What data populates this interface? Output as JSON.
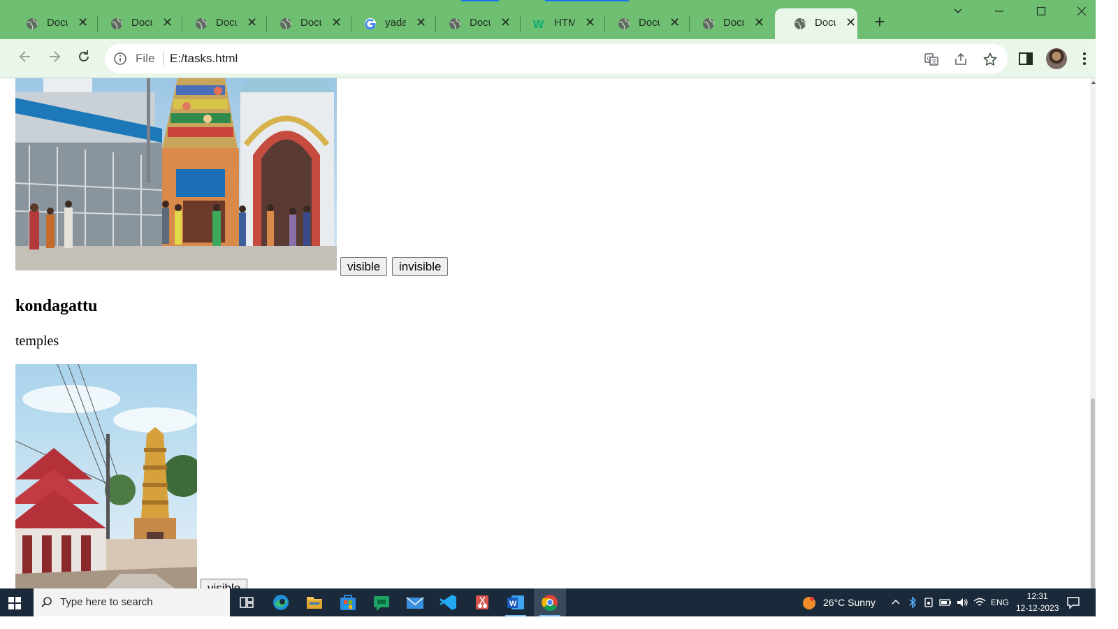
{
  "browser": {
    "tabs": [
      {
        "title": "Docu",
        "favicon": "globe-icon"
      },
      {
        "title": "Docu",
        "favicon": "globe-icon"
      },
      {
        "title": "Docu",
        "favicon": "globe-icon"
      },
      {
        "title": "Docu",
        "favicon": "globe-icon"
      },
      {
        "title": "yada",
        "favicon": "google-icon"
      },
      {
        "title": "Docu",
        "favicon": "globe-icon"
      },
      {
        "title": "HTM",
        "favicon": "w3schools-icon"
      },
      {
        "title": "Docu",
        "favicon": "globe-icon"
      },
      {
        "title": "Docu",
        "favicon": "globe-icon"
      },
      {
        "title": "Docu",
        "favicon": "globe-icon",
        "active": true
      }
    ],
    "tab_close_glyph": "✕",
    "new_tab_glyph": "+",
    "address_scheme_label": "File",
    "address_url": "E:/tasks.html",
    "accent_color": "#6fbf73",
    "toolbar_color": "#eaf6ea"
  },
  "page": {
    "block1": {
      "image_alt": "temple with colorful gopuram",
      "visible_button": "visible",
      "invisible_button": "invisible"
    },
    "heading": "kondagattu",
    "paragraph": "temples",
    "block2": {
      "image_alt": "kondagattu temple",
      "visible_button": "visible"
    }
  },
  "taskbar": {
    "search_placeholder": "Type here to search",
    "weather": "26°C  Sunny",
    "language": "ENG",
    "time": "12:31",
    "date": "12-12-2023",
    "color": "#1b2a3a"
  }
}
